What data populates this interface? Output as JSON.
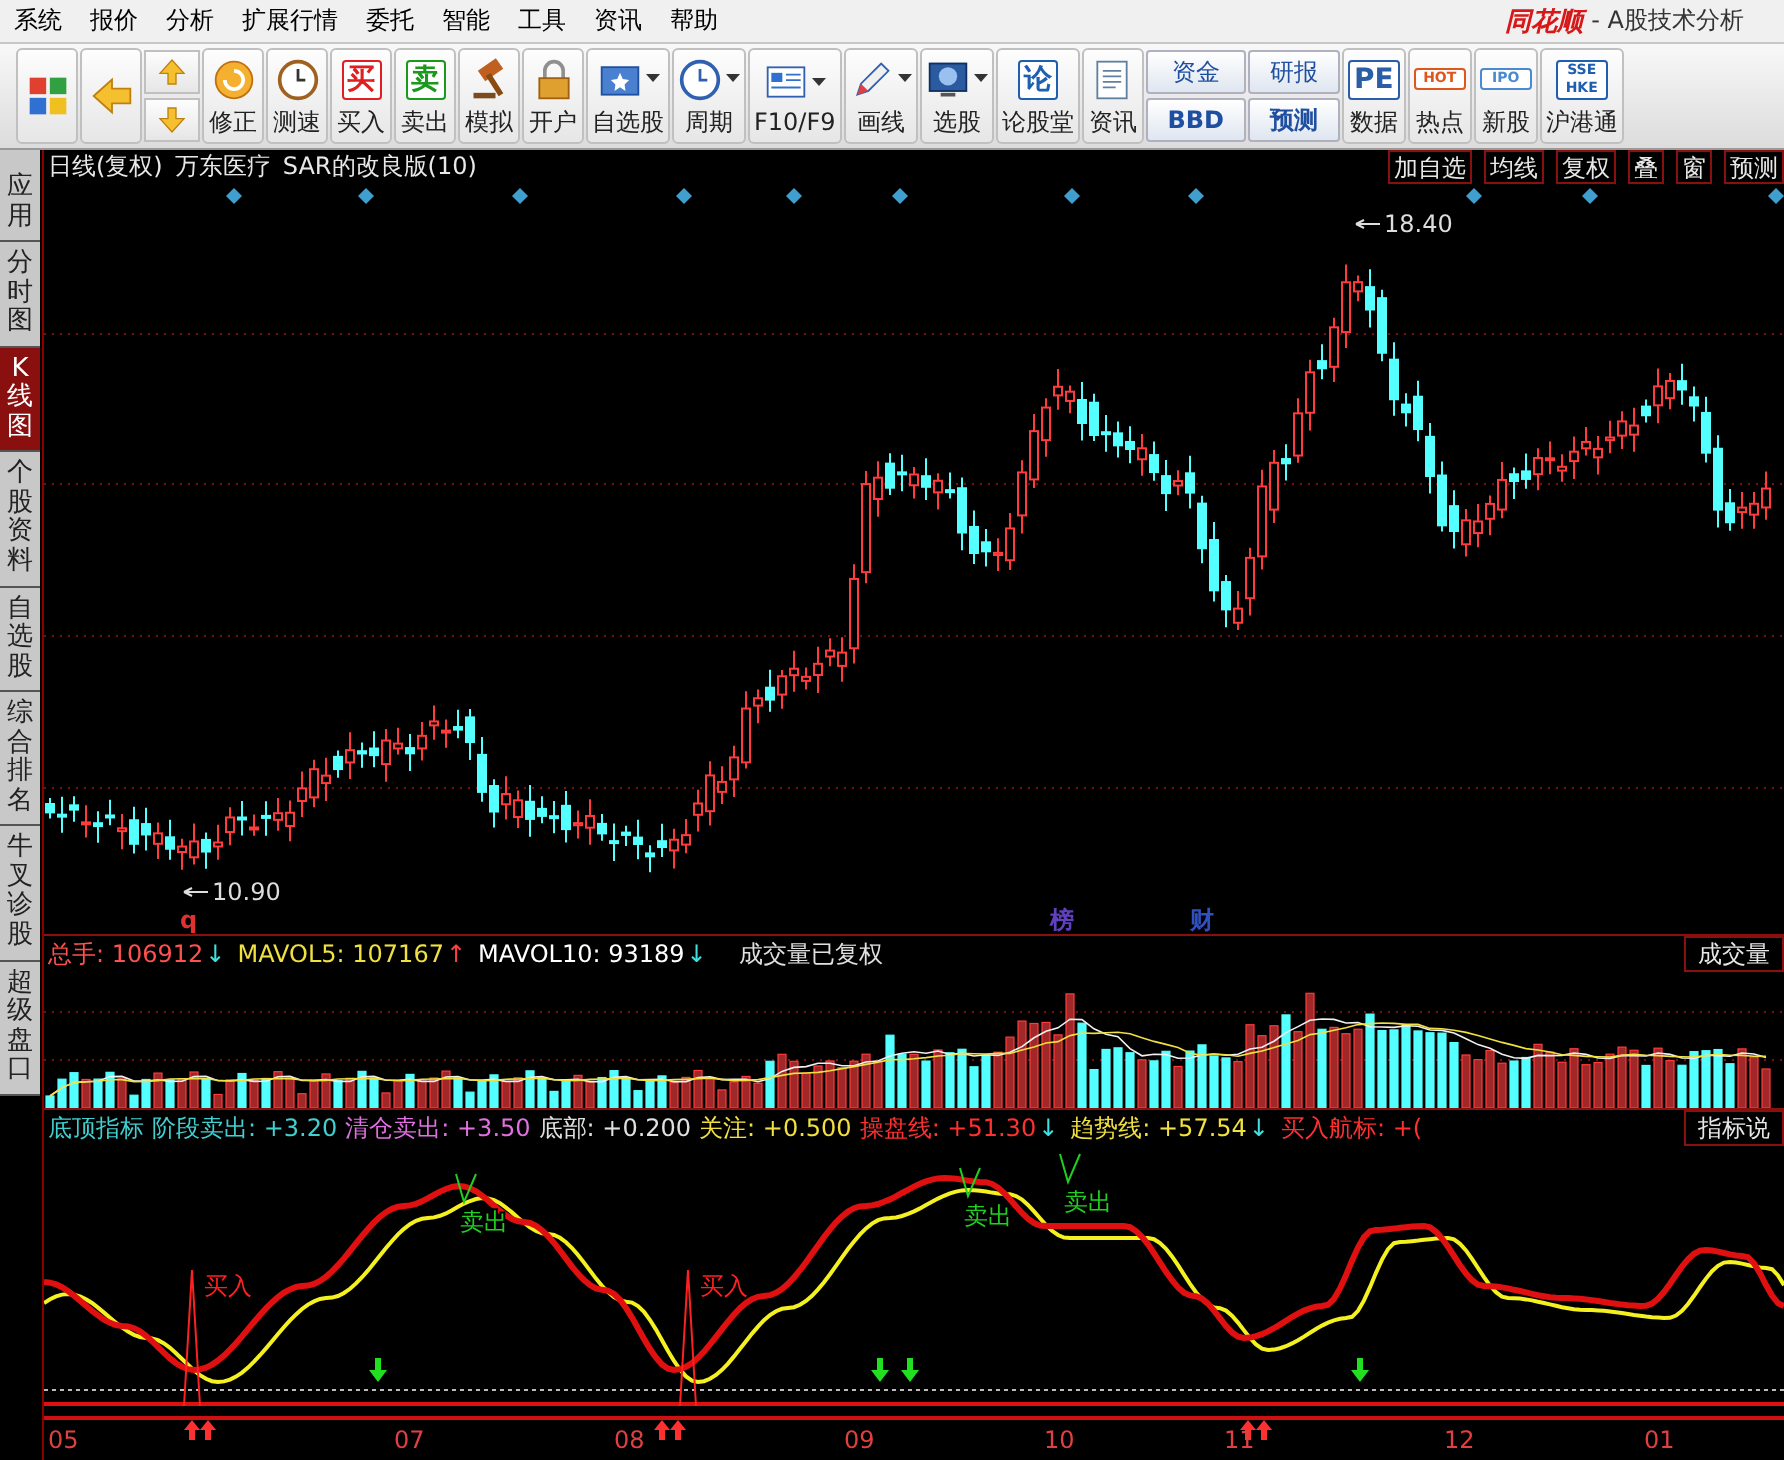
{
  "menu": [
    {
      "label": "系统"
    },
    {
      "label": "报价"
    },
    {
      "label": "分析"
    },
    {
      "label": "扩展行情"
    },
    {
      "label": "委托"
    },
    {
      "label": "智能"
    },
    {
      "label": "工具"
    },
    {
      "label": "资讯"
    },
    {
      "label": "帮助"
    }
  ],
  "brand": {
    "logo": "同花顺",
    "subtitle": "- A股技术分析"
  },
  "toolbar": [
    {
      "kind": "icon"
    },
    {
      "kind": "icon"
    },
    {
      "kind": "updown"
    },
    {
      "kind": "icon",
      "label": "修正"
    },
    {
      "kind": "icon",
      "label": "测速"
    },
    {
      "kind": "glyph",
      "glyph": "买",
      "color": "#e02020",
      "label": "买入"
    },
    {
      "kind": "glyph",
      "glyph": "卖",
      "color": "#1a9a1a",
      "label": "卖出"
    },
    {
      "kind": "icon",
      "label": "模拟"
    },
    {
      "kind": "icon",
      "label": "开户"
    },
    {
      "kind": "dropdown",
      "label": "自选股"
    },
    {
      "kind": "dropdown",
      "label": "周期"
    },
    {
      "kind": "dropdown",
      "label": "F10/F9"
    },
    {
      "kind": "dropdown",
      "label": "画线"
    },
    {
      "kind": "dropdown",
      "label": "选股"
    },
    {
      "kind": "glyph",
      "glyph": "论",
      "color": "#1f5fb0",
      "label": "论股堂"
    },
    {
      "kind": "icon",
      "label": "资讯"
    },
    {
      "kind": "pair",
      "top": "资金",
      "bottom": "BBD"
    },
    {
      "kind": "pair",
      "top": "研报",
      "bottom": "预测"
    },
    {
      "kind": "glyph",
      "glyph": "PE",
      "color": "#2a5fa8",
      "label": "数据"
    },
    {
      "kind": "glyph",
      "glyph": "HOT",
      "color": "#e0561a",
      "label": "热点"
    },
    {
      "kind": "glyph",
      "glyph": "IPO",
      "color": "#4a8ad0",
      "label": "新股"
    },
    {
      "kind": "glyph",
      "glyph": "SSE HKE",
      "color": "#1f5fb0",
      "label": "沪港通"
    }
  ],
  "side_tabs": [
    {
      "label": "应用",
      "selected": false
    },
    {
      "label": "分时图",
      "selected": false
    },
    {
      "label": "K线图",
      "selected": true
    },
    {
      "label": "个股资料",
      "selected": false
    },
    {
      "label": "自选股",
      "selected": false
    },
    {
      "label": "综合排名",
      "selected": false
    },
    {
      "label": "牛叉诊股",
      "selected": false
    },
    {
      "label": "超级盘口",
      "selected": false
    }
  ],
  "chart_header": {
    "period": "日线(复权)",
    "stock": "万东医疗",
    "indicator": "SAR的改良版(10)",
    "buttons": [
      "加自选",
      "均线",
      "复权",
      "叠",
      "窗",
      "预测"
    ]
  },
  "price_chart": {
    "high_label": "18.40",
    "low_label": "10.90",
    "markers": [
      {
        "text": "q",
        "color": "#e03030"
      },
      {
        "text": "榜",
        "color": "#6040c0"
      },
      {
        "text": "财",
        "color": "#3050c0"
      }
    ]
  },
  "volume": {
    "fields": [
      {
        "label": "总手:",
        "value": "106912",
        "arrow": {
          "text": "↓",
          "color": "#40e0e0"
        },
        "color": "#ff5050"
      },
      {
        "label": "MAVOL5:",
        "value": "107167",
        "arrow": {
          "text": "↑",
          "color": "#ff4040"
        },
        "color": "#f0e040"
      },
      {
        "label": "MAVOL10:",
        "value": "93189",
        "arrow": {
          "text": "↓",
          "color": "#40e0e0"
        },
        "color": "#ffffff"
      }
    ],
    "note": "成交量已复权",
    "button": "成交量"
  },
  "indicator": {
    "name": "底顶指标",
    "fields": [
      {
        "label": "阶段卖出:",
        "value": "+3.20",
        "color": "#40d0d0"
      },
      {
        "label": "清仓卖出:",
        "value": "+3.50",
        "color": "#e070e0"
      },
      {
        "label": "底部:",
        "value": "+0.200",
        "color": "#e0e0e0"
      },
      {
        "label": "关注:",
        "value": "+0.500",
        "color": "#f0e040"
      },
      {
        "label": "操盘线:",
        "value": "+51.30",
        "arrow": {
          "text": "↓",
          "color": "#40e0e0"
        },
        "color": "#ff3030"
      },
      {
        "label": "趋势线:",
        "value": "+57.54",
        "arrow": {
          "text": "↓",
          "color": "#40e0e0"
        },
        "color": "#f0e040"
      },
      {
        "label": "买入航标:",
        "value": "+(",
        "color": "#ff3030"
      }
    ],
    "button": "指标说",
    "signals": [
      {
        "kind": "buy",
        "text": "买入"
      },
      {
        "kind": "sell",
        "text": "卖出"
      },
      {
        "kind": "buy",
        "text": "买入"
      },
      {
        "kind": "sell",
        "text": "卖出"
      },
      {
        "kind": "sell",
        "text": "卖出"
      }
    ]
  },
  "x_axis": [
    "05",
    "07",
    "08",
    "09",
    "10",
    "11",
    "12",
    "01"
  ]
}
